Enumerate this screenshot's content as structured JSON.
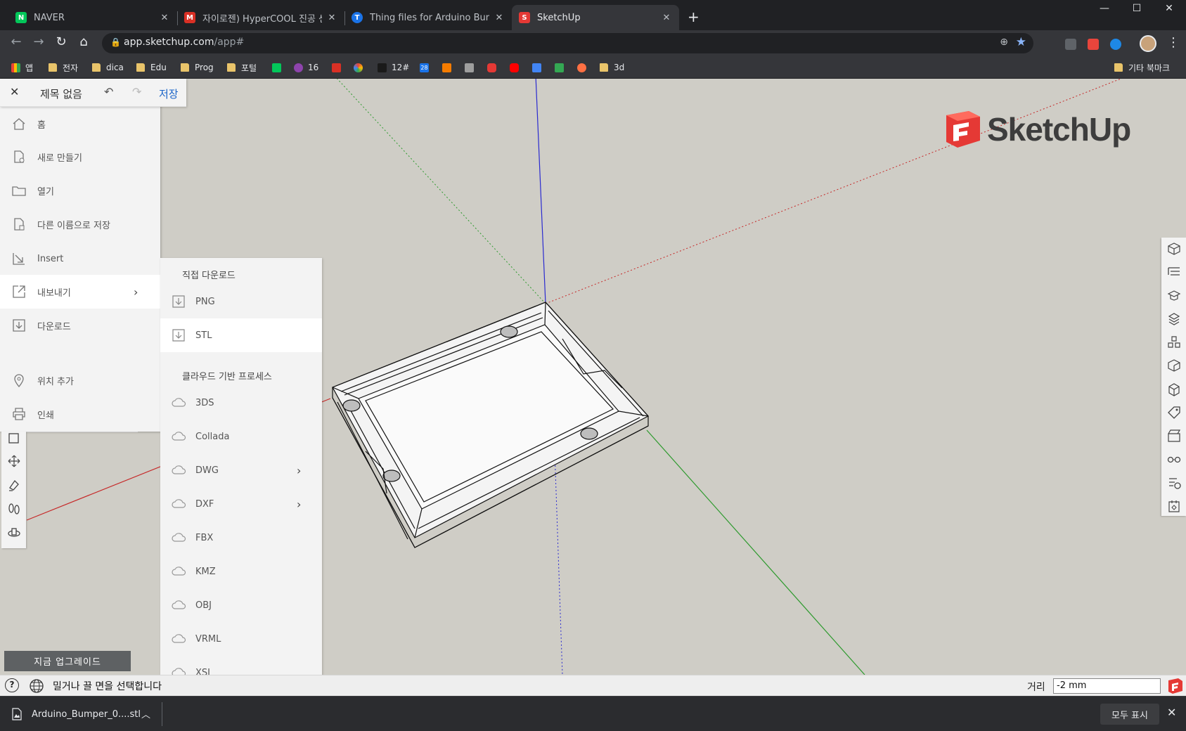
{
  "browser": {
    "tabs": [
      {
        "label": "NAVER",
        "fav_text": "N",
        "fav_color": "#03c75a"
      },
      {
        "label": "자이로젠) HyperCOOL 진공 센서",
        "fav_text": "M",
        "fav_color": "#d93025"
      },
      {
        "label": "Thing files for Arduino Bumper",
        "fav_text": "T",
        "fav_color": "#1a73e8"
      },
      {
        "label": "SketchUp",
        "fav_text": "S",
        "fav_color": "#e53935"
      }
    ],
    "new_tab": "+",
    "url_host": "app.sketchup.com",
    "url_path": "/app#"
  },
  "bookmarks": [
    {
      "label": "앱",
      "kind": "apps"
    },
    {
      "label": "전자",
      "kind": "folder"
    },
    {
      "label": "dica",
      "kind": "folder"
    },
    {
      "label": "Edu",
      "kind": "folder"
    },
    {
      "label": "Prog",
      "kind": "folder"
    },
    {
      "label": "포털",
      "kind": "folder"
    },
    {
      "label": "",
      "kind": "naver"
    },
    {
      "label": "16",
      "kind": "site"
    },
    {
      "label": "",
      "kind": "gmail"
    },
    {
      "label": "",
      "kind": "site"
    },
    {
      "label": "12#",
      "kind": "site"
    },
    {
      "label": "",
      "kind": "calendar"
    },
    {
      "label": "",
      "kind": "site"
    },
    {
      "label": "",
      "kind": "site"
    },
    {
      "label": "",
      "kind": "site"
    },
    {
      "label": "",
      "kind": "youtube"
    },
    {
      "label": "",
      "kind": "site"
    },
    {
      "label": "",
      "kind": "site"
    },
    {
      "label": "",
      "kind": "site"
    },
    {
      "label": "3d",
      "kind": "folder"
    },
    {
      "label": "기타 북마크",
      "kind": "folder"
    }
  ],
  "calendar_day": "28",
  "app": {
    "doc_title": "제목 없음",
    "save_label": "저장",
    "logo_text": "SketchUp",
    "menu": [
      {
        "label": "홈",
        "icon": "home-icon"
      },
      {
        "label": "새로 만들기",
        "icon": "new-file-icon"
      },
      {
        "label": "열기",
        "icon": "folder-open-icon"
      },
      {
        "label": "다른 이름으로 저장",
        "icon": "save-as-icon"
      },
      {
        "label": "Insert",
        "icon": "insert-icon"
      },
      {
        "label": "내보내기",
        "icon": "export-icon"
      },
      {
        "label": "다운로드",
        "icon": "download-icon"
      },
      {
        "label": "위치 추가",
        "icon": "location-pin-icon"
      },
      {
        "label": "인쇄",
        "icon": "print-icon"
      }
    ],
    "submenu": {
      "direct_header": "직접 다운로드",
      "direct": [
        "PNG",
        "STL"
      ],
      "cloud_header": "클라우드 기반 프로세스",
      "cloud": [
        "3DS",
        "Collada",
        "DWG",
        "DXF",
        "FBX",
        "KMZ",
        "OBJ",
        "VRML",
        "XSI"
      ]
    },
    "upgrade_label": "지금 업그레이드",
    "status_hint": "밀거나 끌 면을 선택합니다",
    "distance_label": "거리",
    "distance_value": "-2 mm"
  },
  "downloads": {
    "file": "Arduino_Bumper_0....stl",
    "show_all": "모두 표시"
  },
  "colors": {
    "accent": "#1a64c8",
    "logo_red": "#e53935",
    "axis_red": "#c62828",
    "axis_green": "#2e9a2e",
    "axis_blue": "#2a2ad0"
  }
}
